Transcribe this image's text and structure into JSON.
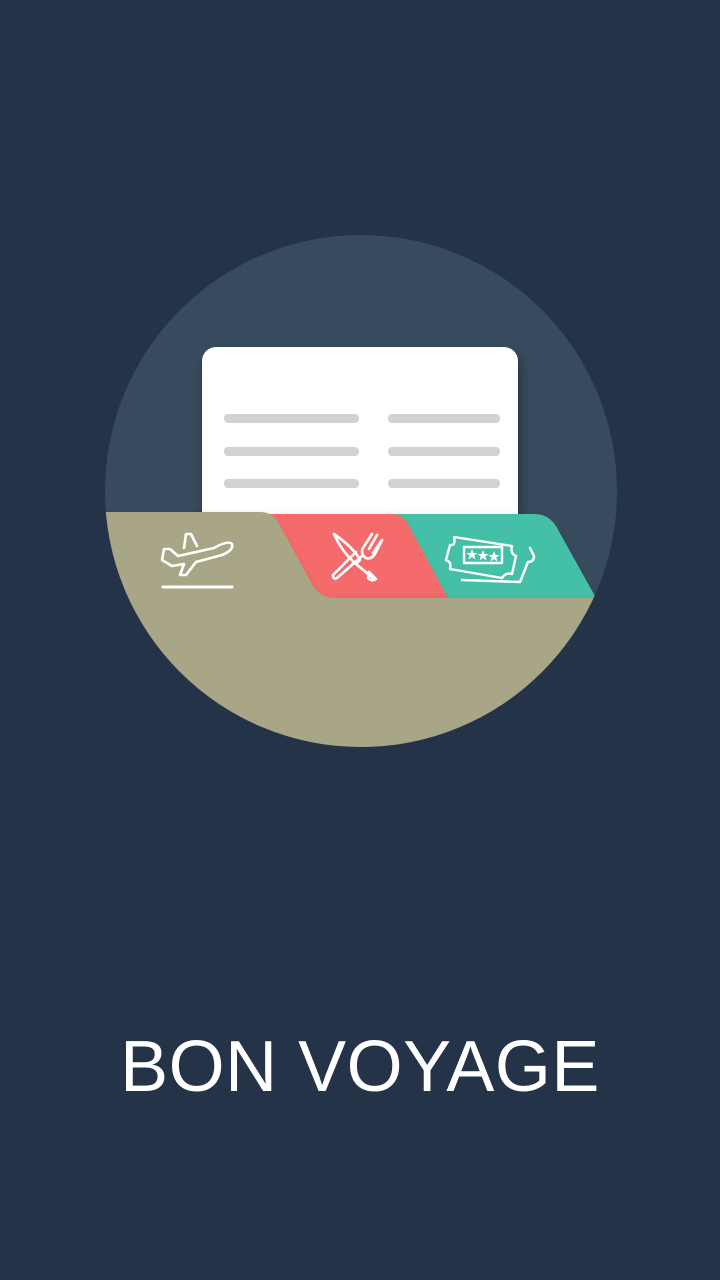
{
  "app": {
    "title": "BON VOYAGE"
  },
  "colors": {
    "background": "#243347",
    "circle": "#384a5d",
    "folder": "#a8a686",
    "card": "#ffffff",
    "card_lines": "#d2d2d2",
    "tab_flights": "#a8a686",
    "tab_dining": "#f56b6b",
    "tab_attractions": "#45c0a8",
    "icon_stroke": "#ffffff",
    "title_text": "#ffffff"
  },
  "tabs": [
    {
      "icon": "airplane-takeoff-icon",
      "category": "flights",
      "selected": true
    },
    {
      "icon": "knife-fork-icon",
      "category": "dining",
      "selected": false
    },
    {
      "icon": "ticket-icon",
      "category": "attractions",
      "selected": false
    }
  ]
}
